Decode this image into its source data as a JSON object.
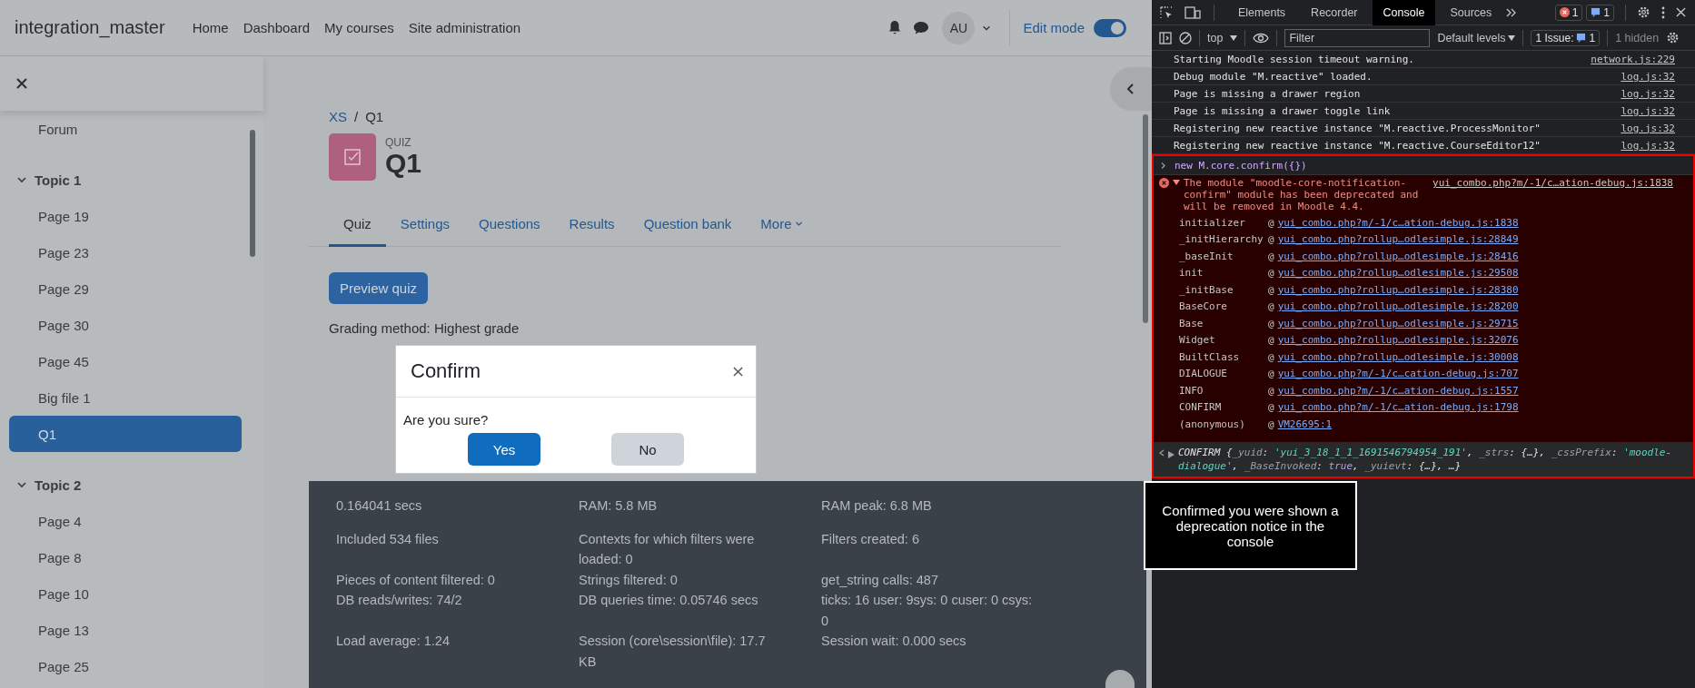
{
  "navbar": {
    "site_name": "integration_master",
    "links": [
      "Home",
      "Dashboard",
      "My courses",
      "Site administration"
    ],
    "avatar": "AU",
    "edit_mode": {
      "label": "Edit mode",
      "on": true
    }
  },
  "drawer": {
    "items": [
      {
        "kind": "item",
        "label": "Forum",
        "selected": false
      },
      {
        "kind": "section",
        "label": "Topic 1",
        "expanded": true,
        "children": [
          {
            "label": "Page 19",
            "selected": false
          },
          {
            "label": "Page 23",
            "selected": false
          },
          {
            "label": "Page 29",
            "selected": false
          },
          {
            "label": "Page 30",
            "selected": false
          },
          {
            "label": "Page 45",
            "selected": false
          },
          {
            "label": "Big file 1",
            "selected": false
          },
          {
            "label": "Q1",
            "selected": true
          }
        ]
      },
      {
        "kind": "section",
        "label": "Topic 2",
        "expanded": true,
        "children": [
          {
            "label": "Page 4",
            "selected": false
          },
          {
            "label": "Page 8",
            "selected": false
          },
          {
            "label": "Page 10",
            "selected": false
          },
          {
            "label": "Page 13",
            "selected": false
          },
          {
            "label": "Page 25",
            "selected": false
          }
        ]
      }
    ]
  },
  "breadcrumb": {
    "items": [
      "XS",
      "Q1"
    ],
    "separator": "/"
  },
  "activity": {
    "type_label": "QUIZ",
    "title": "Q1"
  },
  "tabs": [
    {
      "label": "Quiz",
      "selected": true,
      "kind": "tab"
    },
    {
      "label": "Settings",
      "selected": false,
      "kind": "tab"
    },
    {
      "label": "Questions",
      "selected": false,
      "kind": "tab"
    },
    {
      "label": "Results",
      "selected": false,
      "kind": "tab"
    },
    {
      "label": "Question bank",
      "selected": false,
      "kind": "tab"
    },
    {
      "label": "More",
      "selected": false,
      "kind": "menu"
    }
  ],
  "preview_button": "Preview quiz",
  "grading_text": "Grading method: Highest grade",
  "dialog": {
    "title": "Confirm",
    "message": "Are you sure?",
    "buttons": [
      {
        "label": "Yes",
        "kind": "primary"
      },
      {
        "label": "No",
        "kind": "secondary"
      }
    ]
  },
  "performance": [
    "0.164041 secs",
    "RAM: 5.8 MB",
    "RAM peak: 6.8 MB",
    "Included 534 files",
    "Contexts for which filters were loaded: 0",
    "Filters created: 6",
    "Pieces of content filtered: 0",
    "Strings filtered: 0",
    "get_string calls: 487",
    "DB reads/writes: 74/2",
    "DB queries time: 0.05746 secs",
    "ticks: 16 user: 9sys: 0 cuser: 0 csys: 0",
    "Load average: 1.24",
    "Session (core\\session\\file): 17.7 KB",
    "Session wait: 0.000 secs"
  ],
  "devtools": {
    "tabs": [
      {
        "label": "Elements",
        "selected": false
      },
      {
        "label": "Recorder",
        "selected": false
      },
      {
        "label": "Console",
        "selected": true
      },
      {
        "label": "Sources",
        "selected": false
      }
    ],
    "error_count": "1",
    "message_count": "1",
    "context": "top",
    "filter_placeholder": "Filter",
    "levels": "Default levels",
    "issues": {
      "label": "1 Issue:",
      "count": "1"
    },
    "hidden": "1 hidden",
    "logs": [
      {
        "text": "Starting Moodle session timeout warning.",
        "source": "network.js:229"
      },
      {
        "text": "Debug module \"M.reactive\" loaded.",
        "source": "log.js:32"
      },
      {
        "text": "Page is missing a drawer region",
        "source": "log.js:32"
      },
      {
        "text": "Page is missing a drawer toggle link",
        "source": "log.js:32"
      },
      {
        "text": "Registering new reactive instance \"M.reactive.ProcessMonitor\"",
        "source": "log.js:32"
      },
      {
        "text": "Registering new reactive instance \"M.reactive.CourseEditor12\"",
        "source": "log.js:32"
      }
    ],
    "input": "new M.core.confirm({})",
    "error": {
      "message": "The module \"moodle-core-notification-confirm\" module has been deprecated and will be removed in Moodle 4.4.",
      "source": "yui_combo.php?m/-1/c…ation-debug.js:1838",
      "expanded": true,
      "at_sign": "@",
      "stack": [
        {
          "fn": "initializer",
          "link": "yui_combo.php?m/-1/c…ation-debug.js:1838"
        },
        {
          "fn": "_initHierarchy",
          "link": "yui_combo.php?rollup…odlesimple.js:28849"
        },
        {
          "fn": "_baseInit",
          "link": "yui_combo.php?rollup…odlesimple.js:28416"
        },
        {
          "fn": "init",
          "link": "yui_combo.php?rollup…odlesimple.js:29508"
        },
        {
          "fn": "_initBase",
          "link": "yui_combo.php?rollup…odlesimple.js:28380"
        },
        {
          "fn": "BaseCore",
          "link": "yui_combo.php?rollup…odlesimple.js:28200"
        },
        {
          "fn": "Base",
          "link": "yui_combo.php?rollup…odlesimple.js:29715"
        },
        {
          "fn": "Widget",
          "link": "yui_combo.php?rollup…odlesimple.js:32076"
        },
        {
          "fn": "BuiltClass",
          "link": "yui_combo.php?rollup…odlesimple.js:30008"
        },
        {
          "fn": "DIALOGUE",
          "link": "yui_combo.php?m/-1/c…cation-debug.js:707"
        },
        {
          "fn": "INFO",
          "link": "yui_combo.php?m/-1/c…ation-debug.js:1557"
        },
        {
          "fn": "CONFIRM",
          "link": "yui_combo.php?m/-1/c…ation-debug.js:1798"
        },
        {
          "fn": "(anonymous)",
          "link": "VM26695:1"
        }
      ]
    },
    "result": [
      {
        "kind": "name",
        "text": "CONFIRM "
      },
      {
        "kind": "plain",
        "text": "{"
      },
      {
        "kind": "key",
        "text": "_yuid"
      },
      {
        "kind": "plain",
        "text": ": "
      },
      {
        "kind": "string",
        "text": "'yui_3_18_1_1_1691546794954_191'"
      },
      {
        "kind": "plain",
        "text": ", "
      },
      {
        "kind": "key",
        "text": "_strs"
      },
      {
        "kind": "plain",
        "text": ": {…}, "
      },
      {
        "kind": "key",
        "text": "_cssPrefix"
      },
      {
        "kind": "plain",
        "text": ": "
      },
      {
        "kind": "string",
        "text": "'moodle-dialogue'"
      },
      {
        "kind": "plain",
        "text": ", "
      },
      {
        "kind": "key",
        "text": "_BaseInvoked"
      },
      {
        "kind": "plain",
        "text": ": "
      },
      {
        "kind": "bool",
        "text": "true"
      },
      {
        "kind": "plain",
        "text": ", "
      },
      {
        "kind": "key",
        "text": "_yuievt"
      },
      {
        "kind": "plain",
        "text": ": {…}, …}"
      }
    ]
  },
  "annotation": "Confirmed you were shown a deprecation notice in the console"
}
